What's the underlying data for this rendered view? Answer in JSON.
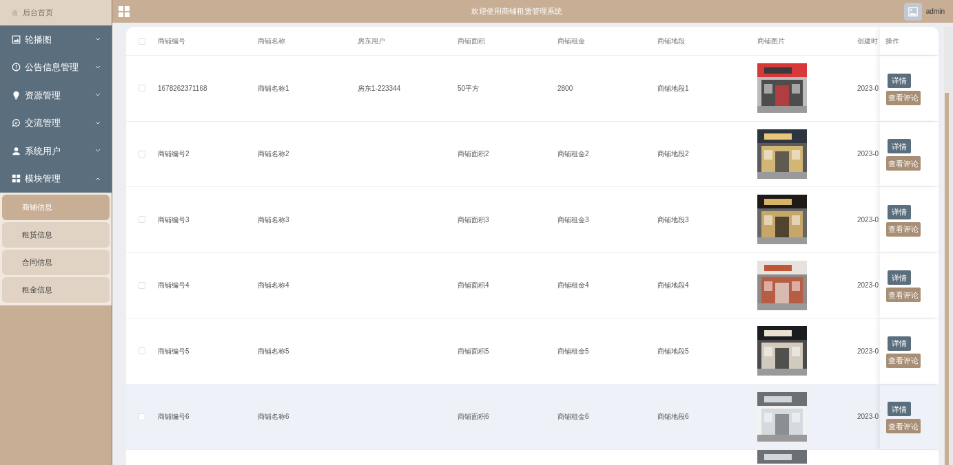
{
  "topbar": {
    "title": "欢迎使用商铺租赁管理系统",
    "user": "admin"
  },
  "sidebar": {
    "home": "后台首页",
    "items": [
      {
        "label": "轮播图",
        "expanded": false
      },
      {
        "label": "公告信息管理",
        "expanded": false
      },
      {
        "label": "资源管理",
        "expanded": false
      },
      {
        "label": "交流管理",
        "expanded": false
      },
      {
        "label": "系统用户",
        "expanded": false
      },
      {
        "label": "模块管理",
        "expanded": true,
        "children": [
          {
            "label": "商铺信息",
            "selected": true
          },
          {
            "label": "租赁信息",
            "selected": false
          },
          {
            "label": "合同信息",
            "selected": false
          },
          {
            "label": "租金信息",
            "selected": false
          }
        ]
      }
    ]
  },
  "table": {
    "all_checked": false,
    "columns": [
      "商铺编号",
      "商铺名称",
      "房东用户",
      "商铺面积",
      "商铺租金",
      "商铺地段",
      "商铺图片",
      "创建时"
    ],
    "action_column": "操作",
    "rows": [
      {
        "cells": [
          "1678262371168",
          "商铺名称1",
          "房东1-223344",
          "50平方",
          "2800",
          "商铺地段1"
        ],
        "created": "2023-0",
        "checked": false,
        "highlighted": false,
        "actions": [
          "详情",
          "查看评论"
        ]
      },
      {
        "cells": [
          "商铺编号2",
          "商铺名称2",
          "",
          "商铺面积2",
          "商铺租金2",
          "商铺地段2"
        ],
        "created": "2023-0",
        "checked": false,
        "highlighted": false,
        "actions": [
          "详情",
          "查看评论"
        ]
      },
      {
        "cells": [
          "商铺编号3",
          "商铺名称3",
          "",
          "商铺面积3",
          "商铺租金3",
          "商铺地段3"
        ],
        "created": "2023-0",
        "checked": false,
        "highlighted": false,
        "actions": [
          "详情",
          "查看评论"
        ]
      },
      {
        "cells": [
          "商铺编号4",
          "商铺名称4",
          "",
          "商铺面积4",
          "商铺租金4",
          "商铺地段4"
        ],
        "created": "2023-0",
        "checked": false,
        "highlighted": false,
        "actions": [
          "详情",
          "查看评论"
        ]
      },
      {
        "cells": [
          "商铺编号5",
          "商铺名称5",
          "",
          "商铺面积5",
          "商铺租金5",
          "商铺地段5"
        ],
        "created": "2023-0",
        "checked": false,
        "highlighted": false,
        "actions": [
          "详情",
          "查看评论"
        ]
      },
      {
        "cells": [
          "商铺编号6",
          "商铺名称6",
          "",
          "商铺面积6",
          "商铺租金6",
          "商铺地段6"
        ],
        "created": "2023-0",
        "checked": false,
        "highlighted": true,
        "actions": [
          "详情",
          "查看评论"
        ]
      }
    ]
  }
}
